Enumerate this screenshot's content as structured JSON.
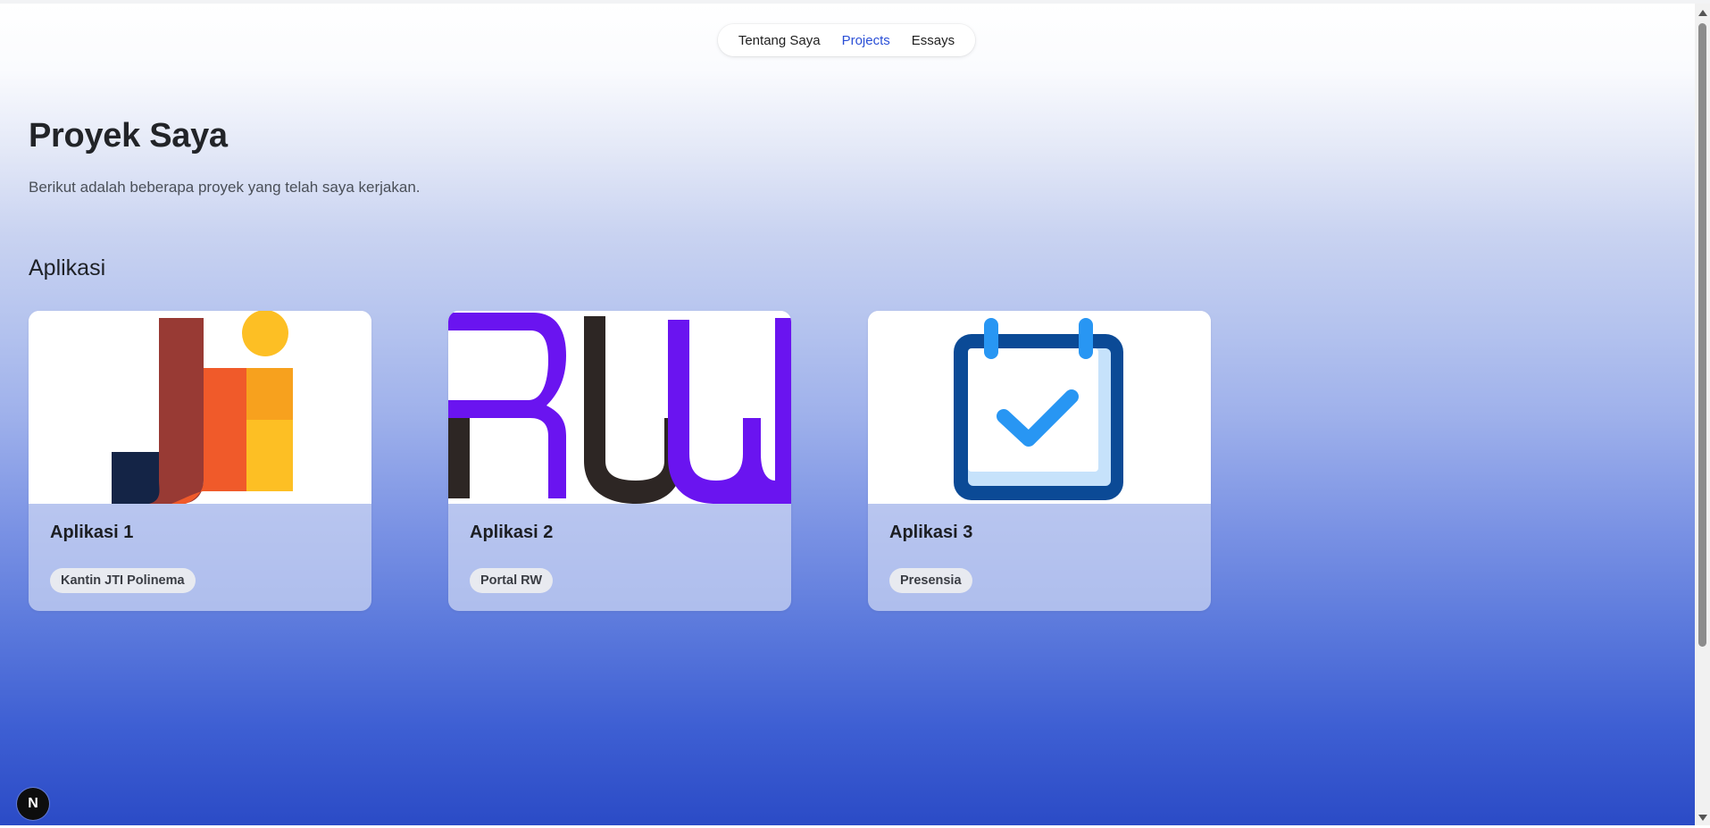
{
  "nav": {
    "items": [
      {
        "label": "Tentang Saya",
        "active": false
      },
      {
        "label": "Projects",
        "active": true
      },
      {
        "label": "Essays",
        "active": false
      }
    ]
  },
  "page": {
    "title": "Proyek Saya",
    "subtitle": "Berikut adalah beberapa proyek yang telah saya kerjakan."
  },
  "section": {
    "title": "Aplikasi"
  },
  "cards": [
    {
      "title": "Aplikasi 1",
      "tag": "Kantin JTI Polinema",
      "logo": "jti-logo"
    },
    {
      "title": "Aplikasi 2",
      "tag": "Portal RW",
      "logo": "rw-logo"
    },
    {
      "title": "Aplikasi 3",
      "tag": "Presensia",
      "logo": "calendar-check-icon"
    }
  ],
  "badge": {
    "label": "N"
  },
  "colors": {
    "accent": "#2a4fd6",
    "gradient_bottom": "#2b4bc6",
    "rw_purple": "#6a14f0",
    "calendar_blue": "#0b4a96"
  }
}
